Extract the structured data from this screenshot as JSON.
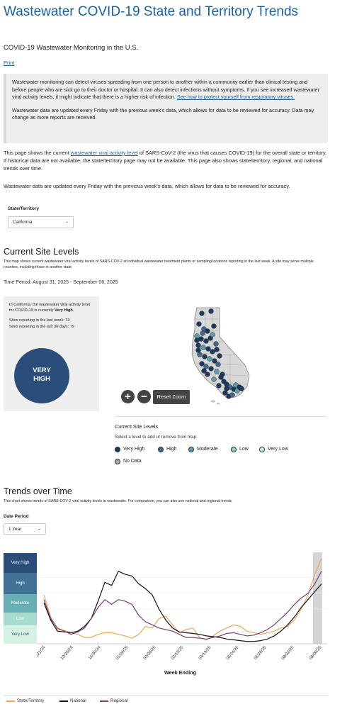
{
  "header": {
    "title": "Wastewater COVID-19 State and Territory Trends",
    "subtitle": "COVID-19 Wastewater Monitoring in the U.S.",
    "print_label": "Print"
  },
  "alert": {
    "p1_text": "Wastewater monitoring can detect viruses spreading from one person to another within a community earlier than clinical testing and before people who are sick go to their doctor or hospital. It can also detect infections without symptoms. If you see increased wastewater viral activity levels, it might indicate that there is a higher risk of infection.",
    "p1_link": "See how to protect yourself from respiratory viruses.",
    "p2_text": "Wastewater data are updated every Friday with the previous week's data, which allows for data to be reviewed for accuracy. Data may change as more reports are received."
  },
  "intro": {
    "p1_before": "This page shows the current ",
    "p1_link": "wastewater viral activity level",
    "p1_after": " of SARS-CoV-2 (the virus that causes COVID-19) for the overall state or territory. If historical data are not available, the state/territory page may not be available. This page also shows state/territory, regional, and national trends over time.",
    "p2": "Wastewater data are updated every Friday with the previous week's data, which allows for data to be reviewed for accuracy."
  },
  "state_select": {
    "label": "State/Territory",
    "value": "California"
  },
  "current_levels": {
    "heading": "Current Site Levels",
    "description": "This map shows current wastewater viral activity levels of SARS-COV-2 at individual wastewater treatment plants or sampling locations reporting in the last week. A site may serve multiple counties, including those in another state.",
    "time_period": "Time Period: August 31, 2025 - September 06, 2025",
    "card_line1": "In California, the wastewater viral activity level for COVID-19 is currently ",
    "card_level_inline": "Very High",
    "card_line1_end": ".",
    "sites_last_week": "Sites reporting in the last week: 73",
    "sites_last_30": "Sites reporting in the last 30 days: 79",
    "circle_line1": "VERY",
    "circle_line2": "HIGH",
    "reset_zoom": "Reset Zoom",
    "zoom_in": "+",
    "zoom_out": "−"
  },
  "map_legend": {
    "title": "Current Site Levels",
    "hint": "Select a level to add or remove from map.",
    "items": [
      {
        "label": "Very High",
        "color": "#1d3a5e"
      },
      {
        "label": "High",
        "color": "#3f6a93"
      },
      {
        "label": "Moderate",
        "color": "#5c9db0"
      },
      {
        "label": "Low",
        "color": "#8fd0c9"
      },
      {
        "label": "Very Low",
        "color": "#c8eedc"
      },
      {
        "label": "No Data",
        "color": "#a9a9a9"
      }
    ]
  },
  "trends": {
    "heading": "Trends over Time",
    "description": "This chart shows trends of SARS-COV-2 viral activity levels in wastewater. For comparison, you can also see national and regional trends.",
    "date_period_label": "Date Period",
    "date_period_value": "1 Year",
    "bands": [
      {
        "label": "Very High",
        "color": "#2a4d79"
      },
      {
        "label": "High",
        "color": "#3f7295"
      },
      {
        "label": "Moderate",
        "color": "#67aeb5"
      },
      {
        "label": "Low",
        "color": "#a7dbd0"
      },
      {
        "label": "Very Low",
        "color": "#d5f1e3"
      }
    ],
    "x_axis_title": "Week Ending",
    "legend": [
      {
        "label": "State/Territory",
        "color": "#f0a55a"
      },
      {
        "label": "National",
        "color": "#111111"
      },
      {
        "label": "Regional",
        "color": "#7a3f7a"
      }
    ]
  },
  "chart_data": {
    "type": "line",
    "xlabel": "Week Ending",
    "ylabel": "",
    "x_tick_labels": [
      "09/21/24",
      "10/26/24",
      "11/30/24",
      "01/04/25",
      "02/08/25",
      "03/15/25",
      "04/19/25",
      "05/24/25",
      "06/28/25",
      "08/02/25",
      "09/06/25"
    ],
    "y_categories": [
      "Very Low",
      "Low",
      "Moderate",
      "High",
      "Very High"
    ],
    "highlighted_period": "most recent weeks (provisional data)",
    "series": [
      {
        "name": "State/Territory",
        "color": "#f0a55a",
        "values": [
          1.9,
          0.5,
          -0.3,
          -0.35,
          -0.5,
          -0.6,
          -0.8,
          -0.8,
          -0.6,
          -0.5,
          -0.5,
          -0.6,
          -0.7,
          -0.85,
          -0.6,
          -0.1,
          -0.2,
          0.4,
          0.55,
          0.0,
          -0.5,
          -0.3,
          -0.2,
          -0.8,
          -0.95,
          -0.7,
          -0.4,
          -0.2,
          0.0,
          -0.1,
          -0.4,
          -0.5,
          -0.6,
          -0.5,
          -0.4,
          -0.2,
          -0.1,
          0.3,
          1.0,
          1.9,
          3.2,
          4.2
        ]
      },
      {
        "name": "National",
        "color": "#111111",
        "values": [
          1.4,
          0.3,
          -0.4,
          -0.45,
          -0.5,
          -0.4,
          -0.1,
          0.4,
          1.5,
          2.7,
          2.5,
          3.4,
          3.2,
          3.1,
          2.6,
          2.3,
          1.9,
          1.0,
          0.3,
          -0.2,
          -0.45,
          -0.5,
          -0.55,
          -0.6,
          -0.7,
          -0.75,
          -0.8,
          -0.9,
          -0.95,
          -1.0,
          -1.05,
          -1.05,
          -1.0,
          -0.9,
          -0.7,
          -0.4,
          0.0,
          0.5,
          1.1,
          1.6,
          2.1,
          2.6
        ]
      },
      {
        "name": "Regional",
        "color": "#7a3f7a",
        "values": [
          1.6,
          0.4,
          -0.2,
          -0.4,
          -0.6,
          -0.45,
          -0.2,
          0.4,
          1.1,
          1.6,
          1.3,
          1.6,
          1.5,
          1.3,
          0.6,
          0.2,
          0.0,
          -0.2,
          -0.3,
          -0.4,
          -0.6,
          -0.8,
          -0.8,
          -0.85,
          -0.9,
          -0.8,
          -0.7,
          -0.55,
          -0.5,
          -0.6,
          -0.7,
          -0.65,
          -0.5,
          -0.3,
          0.0,
          0.4,
          0.8,
          1.3,
          1.7,
          2.0,
          2.6,
          3.4
        ]
      }
    ]
  }
}
